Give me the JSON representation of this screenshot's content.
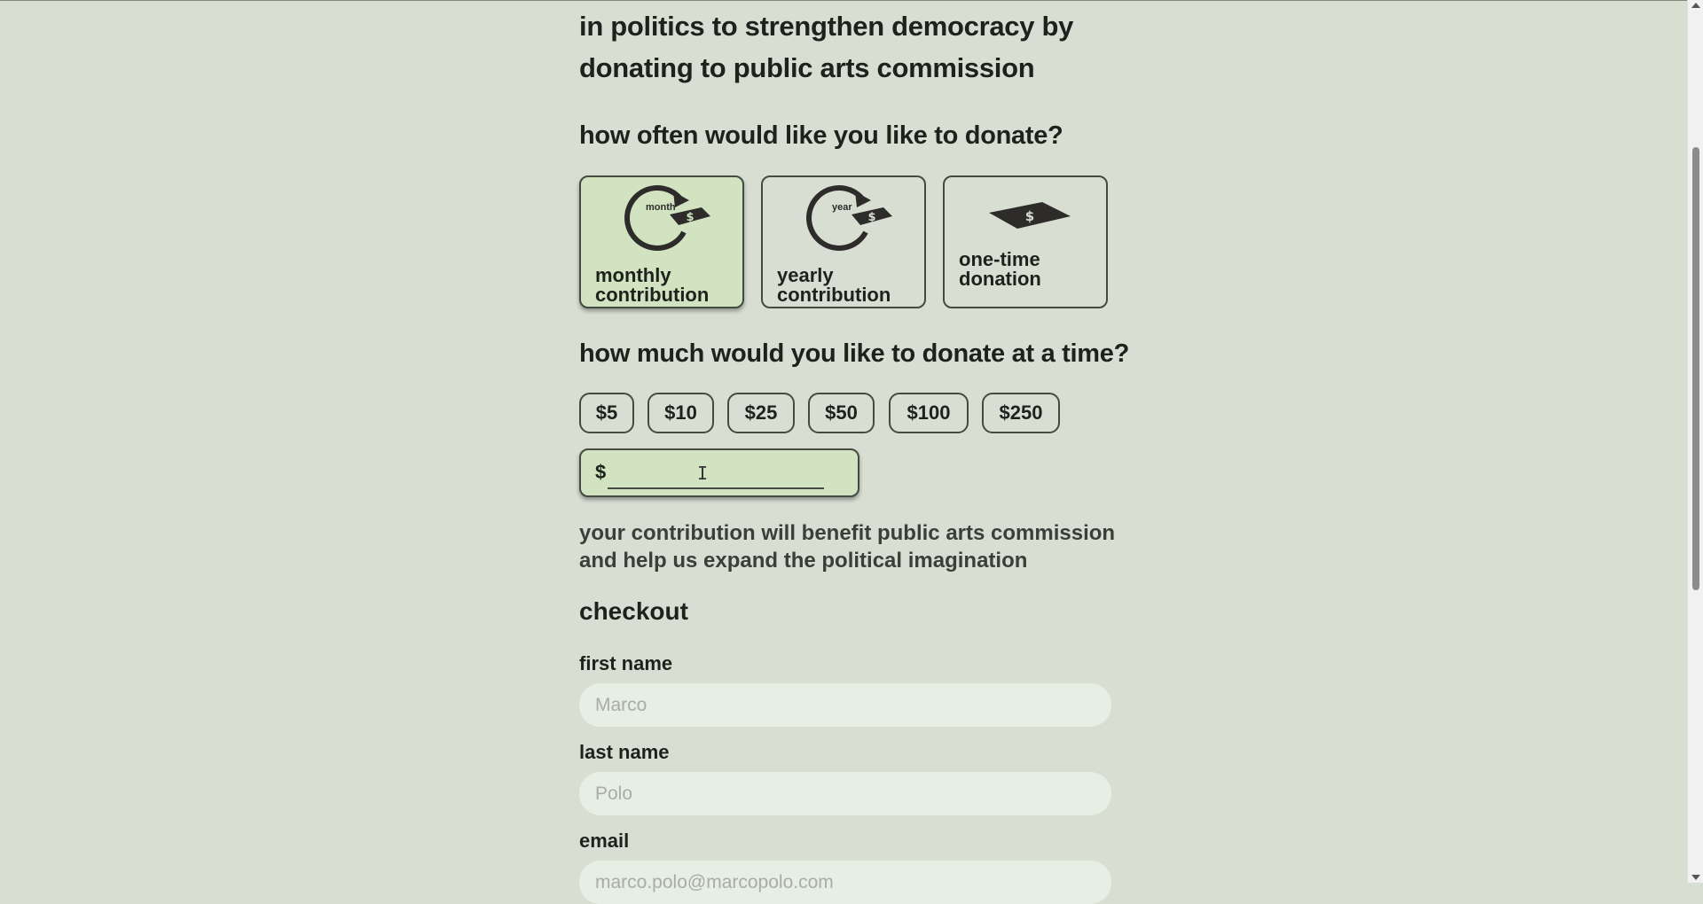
{
  "intro": {
    "line1": "in politics to strengthen democracy by",
    "line2": "donating to public arts commission"
  },
  "frequency": {
    "question": "how often would like you like to donate?",
    "options": [
      {
        "icon_text": "month",
        "label1": "monthly",
        "label2": "contribution",
        "selected": true
      },
      {
        "icon_text": "year",
        "label1": "yearly",
        "label2": "contribution",
        "selected": false
      },
      {
        "label1": "one-time",
        "label2": "donation",
        "selected": false
      }
    ]
  },
  "amount": {
    "question": "how much would you like to donate at a time?",
    "options": [
      "$5",
      "$10",
      "$25",
      "$50",
      "$100",
      "$250"
    ],
    "currency_symbol": "$",
    "custom_value": ""
  },
  "benefit": {
    "line1": "your contribution will benefit public arts commission",
    "line2": "and help us expand the political imagination"
  },
  "checkout": {
    "title": "checkout",
    "first_name_label": "first name",
    "first_name_placeholder": "Marco",
    "last_name_label": "last name",
    "last_name_placeholder": "Polo",
    "email_label": "email",
    "email_placeholder": "marco.polo@marcopolo.com"
  },
  "colors": {
    "background": "#d8dfd2",
    "selected_card": "#d1e3c0",
    "text": "#1e221c",
    "input_background": "#e7eee4"
  }
}
